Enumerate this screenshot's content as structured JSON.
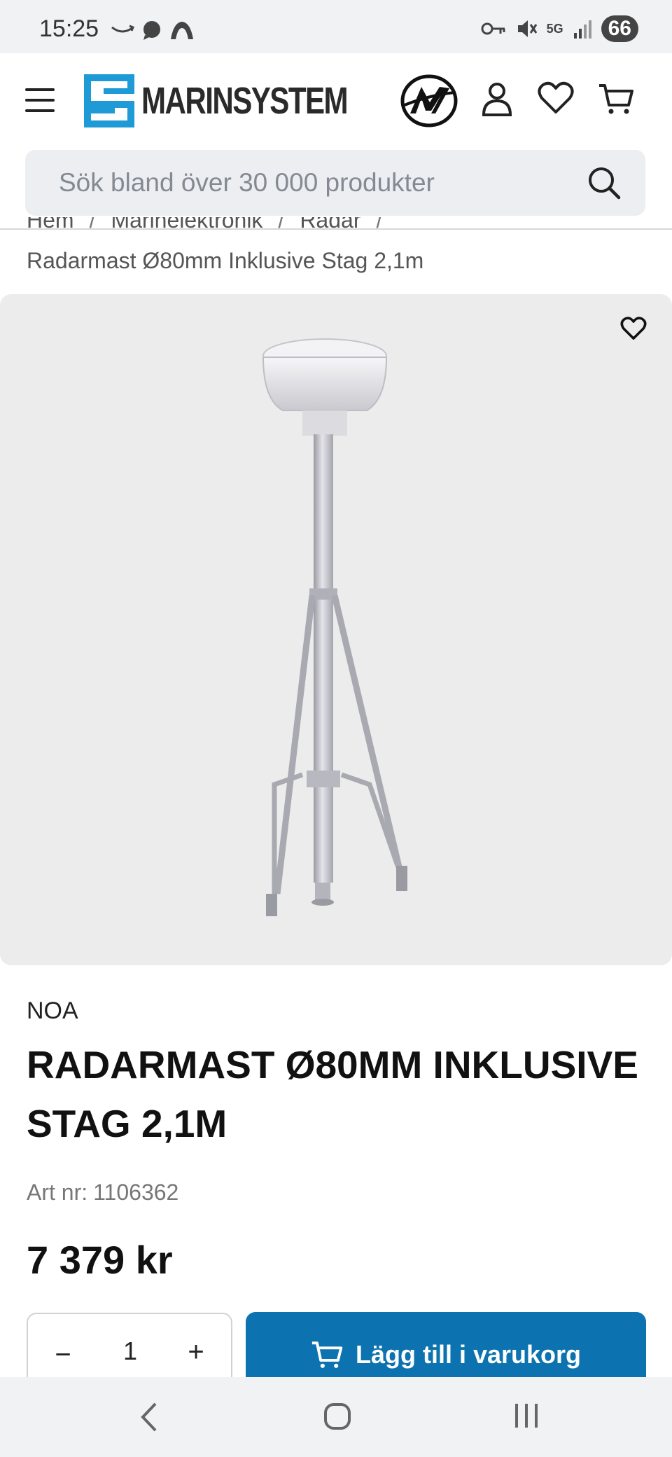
{
  "status_bar": {
    "time": "15:25",
    "battery": "66",
    "icons": [
      "amazon-icon",
      "chat-icon",
      "cloud-icon",
      "key-icon",
      "mute-icon",
      "5g-icon",
      "signal-icon",
      "battery-icon"
    ],
    "network": "5G"
  },
  "header": {
    "logo_text": "MARINSYSTEM",
    "brand_color": "#1e9ad6",
    "icons": [
      "menu-icon",
      "mercury-logo-icon",
      "account-icon",
      "heart-icon",
      "cart-icon"
    ]
  },
  "search": {
    "placeholder": "Sök bland över 30 000 produkter"
  },
  "breadcrumb": {
    "items": [
      "Hem",
      "Marinelektronik",
      "Radar"
    ],
    "separator": "/",
    "current": "Radarmast Ø80mm Inklusive Stag 2,1m"
  },
  "product": {
    "brand": "NOA",
    "title": "RADARMAST Ø80MM INKLUSIVE STAG 2,1M",
    "sku_label": "Art nr:",
    "sku_value": "1106362",
    "price": "7 379 kr"
  },
  "cart": {
    "qty_minus": "−",
    "qty_value": "1",
    "qty_plus": "+",
    "add_label": "Lägg till i varukorg",
    "button_color": "#0c73b0"
  },
  "nav": {
    "icons": [
      "back-icon",
      "home-icon",
      "recents-icon"
    ]
  }
}
